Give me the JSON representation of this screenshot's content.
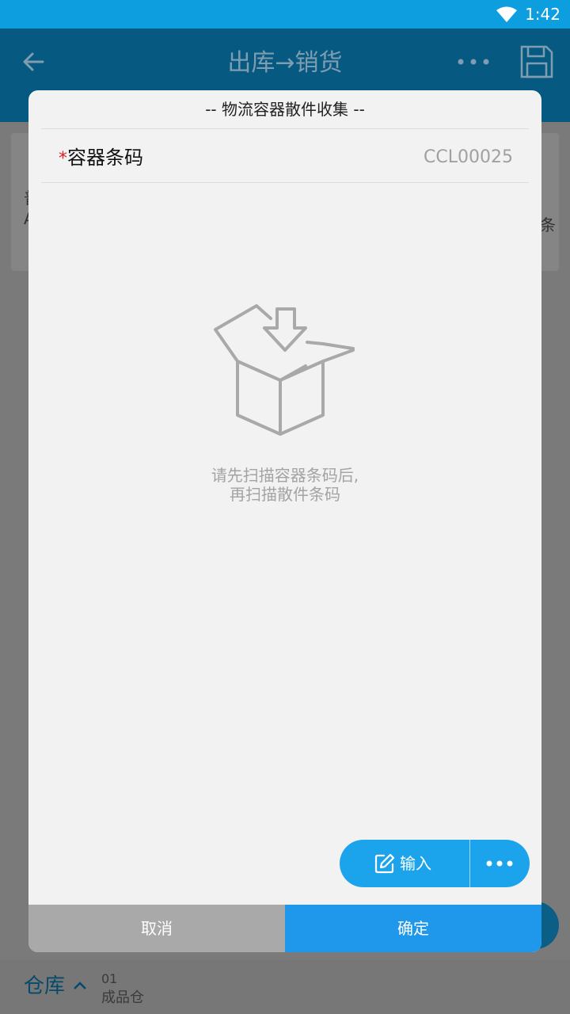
{
  "status_bar": {
    "time": "1:42",
    "wifi_icon": "wifi-icon"
  },
  "app_bar": {
    "title": "出库→销货",
    "back_icon": "back-arrow-icon",
    "more_icon": "more-horizontal-icon",
    "save_icon": "save-icon"
  },
  "background_card": {
    "peek_text_1": "普",
    "peek_text_2": "A",
    "peek_text_right": "条"
  },
  "dialog": {
    "title": "-- 物流容器散件收集 --",
    "field": {
      "required_mark": "*",
      "label": "容器条码",
      "value": "CCL00025"
    },
    "empty_state": {
      "icon": "box-download-icon",
      "hint_line1": "请先扫描容器条码后,",
      "hint_line2": "再扫描散件条码"
    },
    "actions": {
      "input_label": "输入",
      "input_icon": "edit-icon",
      "more_icon": "more-horizontal-icon"
    },
    "buttons": {
      "cancel": "取消",
      "confirm": "确定"
    }
  },
  "bottom_bar": {
    "label": "仓库",
    "chevron": "chevron-up-icon",
    "code": "01",
    "name": "成品仓"
  },
  "colors": {
    "status_bar": "#0c9ede",
    "app_bar": "#065a82",
    "accent": "#1ba4ec",
    "confirm": "#1f98ec",
    "cancel": "#a9a9a9",
    "required": "#e02020"
  }
}
